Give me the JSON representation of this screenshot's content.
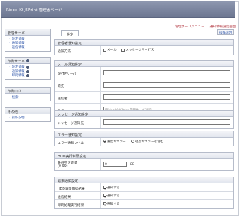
{
  "header": {
    "title": "Ridoc IO JSPrint 管理者ページ"
  },
  "top_links": [
    "管理サーバメニュー",
    "通知情報設定画面"
  ],
  "sidebar": {
    "management": {
      "title": "管理サーバ",
      "items": [
        "設定情報",
        "通知情報",
        "送信情報"
      ]
    },
    "print": {
      "title": "印刷サーバ",
      "items": [
        "設定情報",
        "通知情報",
        "印刷情報"
      ]
    },
    "log": {
      "title": "印刷ログ",
      "items": [
        "検索"
      ]
    },
    "other": {
      "title": "その他",
      "items": [
        "操作説明"
      ]
    }
  },
  "tab": {
    "label": "設定"
  },
  "help_link": "操作説明",
  "admin_notify": {
    "title": "管理者通知設定",
    "method_label": "通知方法",
    "opt_mail": "メール",
    "opt_message": "メッセージサービス"
  },
  "mail": {
    "title": "メール通知設定",
    "smtp_label": "SMTPサーバ",
    "to_label": "宛先",
    "from_label": "送信者",
    "subject_label": "件名",
    "subject_value": "[Ridoc IO JSPrint 管理サーバ 通知]"
  },
  "message": {
    "title": "メッセージ通知設定",
    "dest_label": "メッセージ通知先"
  },
  "error": {
    "title": "エラー通知設定",
    "level_label": "エラー通知レベル",
    "opt_severe": "重度なエラー",
    "opt_minor": "軽度なエラーを含む"
  },
  "hdd": {
    "title": "HDD実行制限設定",
    "min_label": "最低空き容量",
    "range_label": "(0-99)",
    "min_value": "0",
    "unit": "GB"
  },
  "result": {
    "title": "結果通知設定",
    "hdd_label": "HDD容量確認結果",
    "send_label": "送信結果",
    "print_label": "印刷処理実行結果",
    "notify_label": "通知する"
  }
}
